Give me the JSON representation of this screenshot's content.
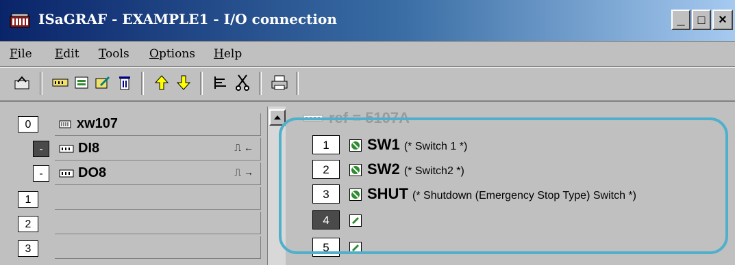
{
  "window": {
    "title": "ISaGRAF - EXAMPLE1 - I/O connection",
    "controls": [
      "_",
      "□",
      "×"
    ]
  },
  "menu": [
    "File",
    "Edit",
    "Tools",
    "Options",
    "Help"
  ],
  "toolbar": {
    "icons": [
      "open-icon",
      "connect-icon",
      "board-icon",
      "edit-icon",
      "delete-icon",
      "move-up-icon",
      "move-down-icon",
      "align-icon",
      "cut-icon",
      "print-icon"
    ]
  },
  "left": {
    "rows": [
      {
        "num": "0",
        "label": "xw107",
        "icon": "board-icon"
      },
      {
        "num": "-",
        "label": "DI8",
        "icon": "input-module-icon",
        "signal": "⎍ ←"
      },
      {
        "num": "-",
        "label": "DO8",
        "icon": "output-module-icon",
        "signal": "⎍ →"
      },
      {
        "num": "1",
        "label": ""
      },
      {
        "num": "2",
        "label": ""
      },
      {
        "num": "3",
        "label": ""
      }
    ]
  },
  "right": {
    "ref": "ref = 5107A",
    "channels": [
      {
        "num": "1",
        "name": "SW1",
        "comment": "(* Switch 1 *)"
      },
      {
        "num": "2",
        "name": "SW2",
        "comment": "(* Switch2 *)"
      },
      {
        "num": "3",
        "name": "SHUT",
        "comment": "(* Shutdown (Emergency Stop Type) Switch *)"
      },
      {
        "num": "4",
        "name": "",
        "comment": ""
      },
      {
        "num": "5",
        "name": "",
        "comment": ""
      }
    ]
  },
  "colors": {
    "highlight": "#4fb0cc",
    "title_start": "#0a246a",
    "connected_icon": "#2e8b2e"
  }
}
